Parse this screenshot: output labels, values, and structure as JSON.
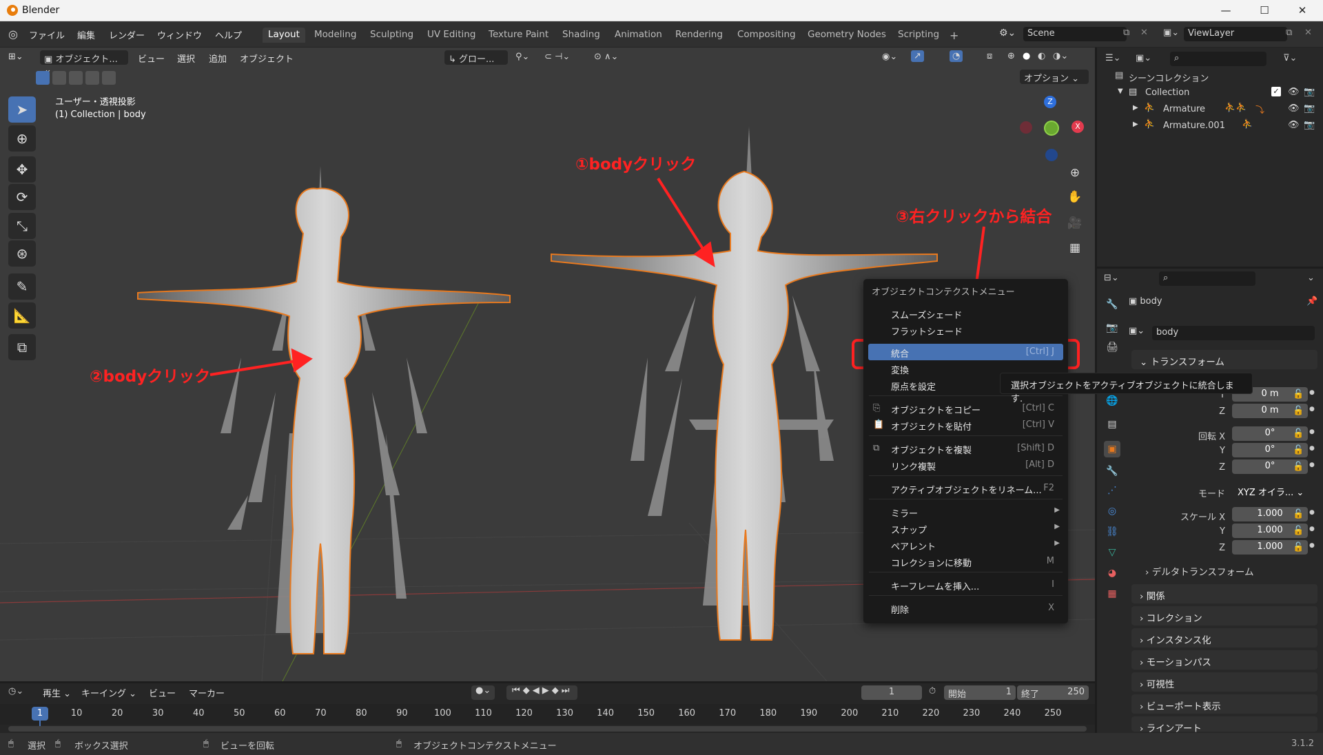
{
  "window": {
    "title": "Blender",
    "minimize": "—",
    "maximize": "☐",
    "close": "✕"
  },
  "menus": [
    "ファイル",
    "編集",
    "レンダー",
    "ウィンドウ",
    "ヘルプ"
  ],
  "workspaces": [
    "Layout",
    "Modeling",
    "Sculpting",
    "UV Editing",
    "Texture Paint",
    "Shading",
    "Animation",
    "Rendering",
    "Compositing",
    "Geometry Nodes",
    "Scripting"
  ],
  "add_tab": "+",
  "scene": {
    "value": "Scene",
    "view_layer": "ViewLayer"
  },
  "viewport": {
    "mode": "オブジェクト...",
    "menus": [
      "ビュー",
      "選択",
      "追加",
      "オブジェクト"
    ],
    "transform_orientation": "グロー...",
    "options": "オプション",
    "view_name": "ユーザー・透視投影",
    "collection_info": "(1) Collection | body",
    "gizmo": {
      "z": "Z",
      "x": "X",
      "y": "Y"
    }
  },
  "annotations": {
    "a1": "①bodyクリック",
    "a2": "②bodyクリック",
    "a3": "③右クリックから結合"
  },
  "context_menu": {
    "title": "オブジェクトコンテクストメニュー",
    "items": [
      {
        "label": "スムーズシェード",
        "shortcut": ""
      },
      {
        "label": "フラットシェード",
        "shortcut": ""
      },
      {
        "label": "統合",
        "shortcut": "[Ctrl] J"
      },
      {
        "label": "変換",
        "shortcut": ""
      },
      {
        "label": "原点を設定",
        "shortcut": ""
      },
      {
        "label": "オブジェクトをコピー",
        "shortcut": "[Ctrl] C"
      },
      {
        "label": "オブジェクトを貼付",
        "shortcut": "[Ctrl] V"
      },
      {
        "label": "オブジェクトを複製",
        "shortcut": "[Shift] D"
      },
      {
        "label": "リンク複製",
        "shortcut": "[Alt] D"
      },
      {
        "label": "アクティブオブジェクトをリネーム...",
        "shortcut": "F2"
      },
      {
        "label": "ミラー",
        "shortcut": ""
      },
      {
        "label": "スナップ",
        "shortcut": ""
      },
      {
        "label": "ペアレント",
        "shortcut": ""
      },
      {
        "label": "コレクションに移動",
        "shortcut": "M"
      },
      {
        "label": "キーフレームを挿入...",
        "shortcut": "I"
      },
      {
        "label": "削除",
        "shortcut": "X"
      }
    ]
  },
  "tooltip": "選択オブジェクトをアクティブオブジェクトに統合します.",
  "outliner": {
    "scene_collection": "シーンコレクション",
    "collection": "Collection",
    "items": [
      "Armature",
      "Armature.001"
    ]
  },
  "properties": {
    "object_name": "body",
    "data_name": "body",
    "transform_header": "トランスフォーム",
    "location": {
      "y": "0 m",
      "z": "0 m"
    },
    "rotation_label": "回転 X",
    "rotation": {
      "x": "0°",
      "y": "0°",
      "z": "0°"
    },
    "mode_label": "モード",
    "mode_value": "XYZ オイラ...",
    "scale_label": "スケール X",
    "scale": {
      "x": "1.000",
      "y": "1.000",
      "z": "1.000"
    },
    "axis": {
      "y": "Y",
      "z": "Z"
    },
    "delta": "デルタトランスフォーム",
    "sections": [
      "関係",
      "コレクション",
      "インスタンス化",
      "モーションパス",
      "可視性",
      "ビューポート表示",
      "ラインアート"
    ]
  },
  "timeline": {
    "menus": [
      "再生",
      "キーイング",
      "ビュー",
      "マーカー"
    ],
    "current_frame": "1",
    "start_label": "開始",
    "start": "1",
    "end_label": "終了",
    "end": "250",
    "ticks": [
      "1",
      "10",
      "20",
      "30",
      "40",
      "50",
      "60",
      "70",
      "80",
      "90",
      "100",
      "110",
      "120",
      "130",
      "140",
      "150",
      "160",
      "170",
      "180",
      "190",
      "200",
      "210",
      "220",
      "230",
      "240",
      "250"
    ]
  },
  "status": {
    "select": "選択",
    "box_select": "ボックス選択",
    "rotate_view": "ビューを回転",
    "context_menu": "オブジェクトコンテクストメニュー",
    "version": "3.1.2"
  },
  "colors": {
    "accent": "#4772b3",
    "annotation": "#ff2222",
    "selection_outline": "#e8791e"
  }
}
